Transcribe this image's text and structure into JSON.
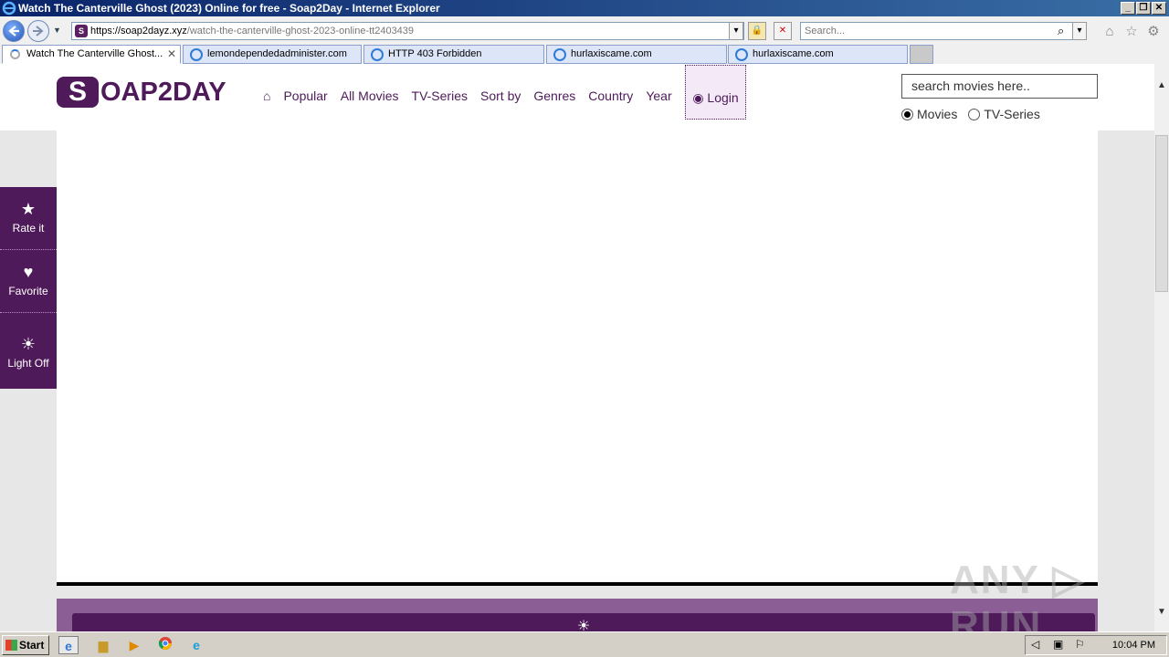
{
  "window": {
    "title": "Watch The Canterville Ghost (2023) Online for free - Soap2Day - Internet Explorer",
    "minimize": "_",
    "restore": "❐",
    "close": "✕"
  },
  "address_bar": {
    "url_host": "https://soap2dayz.xyz",
    "url_path": "/watch-the-canterville-ghost-2023-online-tt2403439",
    "search_placeholder": "Search..."
  },
  "tabs": [
    {
      "label": "Watch The Canterville Ghost...",
      "active": true
    },
    {
      "label": "lemondependedadminister.com",
      "active": false
    },
    {
      "label": "HTTP 403 Forbidden",
      "active": false
    },
    {
      "label": "hurlaxiscame.com",
      "active": false
    },
    {
      "label": "hurlaxiscame.com",
      "active": false
    }
  ],
  "site": {
    "logo_s": "S",
    "logo_rest": "OAP2DAY",
    "nav": [
      "Popular",
      "All Movies",
      "TV-Series",
      "Sort by",
      "Genres",
      "Country",
      "Year"
    ],
    "login": "Login",
    "search_placeholder": "search movies here..",
    "radio_movies": "Movies",
    "radio_tv": "TV-Series"
  },
  "side_panel": {
    "rate": "Rate it",
    "favorite": "Favorite",
    "light": "Light Off"
  },
  "watermark": "ANY ▷ RUN",
  "taskbar": {
    "start": "Start",
    "clock": "10:04 PM"
  },
  "colors": {
    "brand": "#4e1a59",
    "login_bg": "#f3e9f7"
  }
}
